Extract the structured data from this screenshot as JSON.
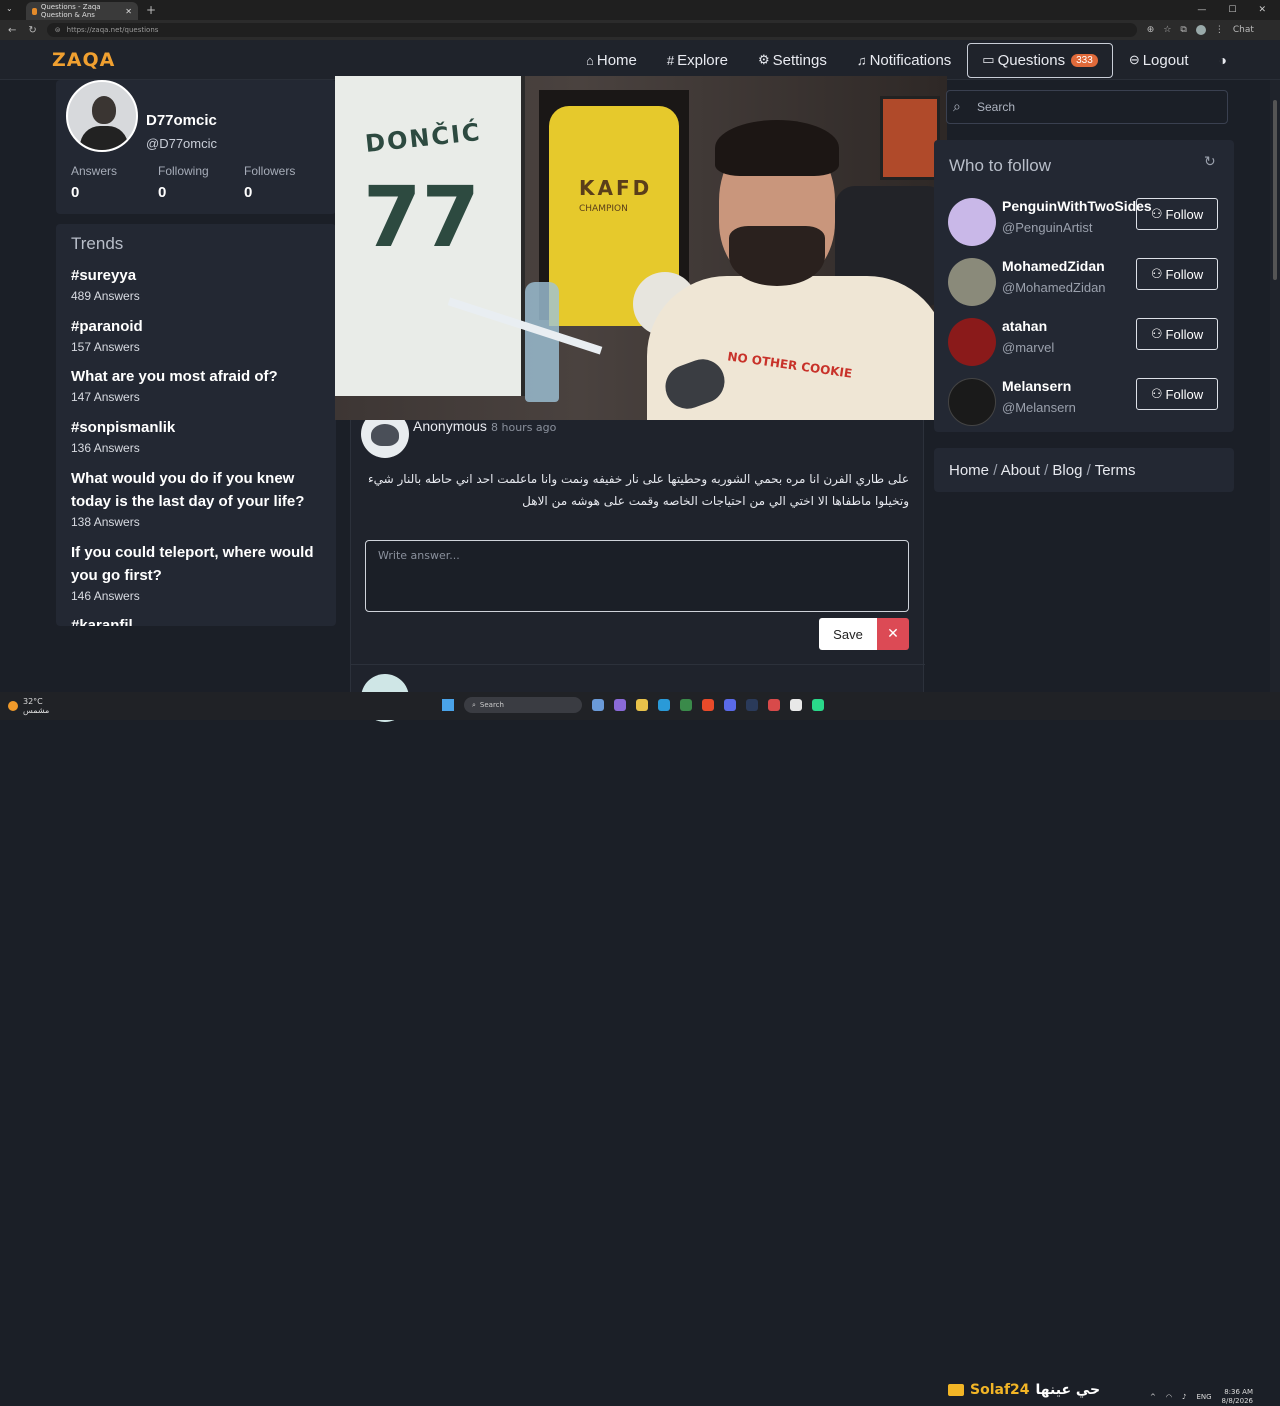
{
  "browser": {
    "tab_title": "Questions - Zaqa Question & Ans",
    "url": "https://zaqa.net/questions",
    "chat_label": "Chat"
  },
  "site": {
    "logo": "ZAQA",
    "nav": [
      {
        "label": "Home",
        "icon": "home-icon"
      },
      {
        "label": "Explore",
        "icon": "hash-icon"
      },
      {
        "label": "Settings",
        "icon": "gear-icon"
      },
      {
        "label": "Notifications",
        "icon": "bell-icon"
      },
      {
        "label": "Questions",
        "icon": "chat-icon",
        "badge": "333"
      },
      {
        "label": "Logout",
        "icon": "logout-icon"
      }
    ]
  },
  "profile": {
    "name": "D77omcic",
    "handle": "@D77omcic",
    "stats": [
      {
        "label": "Answers",
        "value": "0"
      },
      {
        "label": "Following",
        "value": "0"
      },
      {
        "label": "Followers",
        "value": "0"
      }
    ]
  },
  "trends": {
    "title": "Trends",
    "items": [
      {
        "tag": "#sureyya",
        "count": "489 Answers"
      },
      {
        "tag": "#paranoid",
        "count": "157 Answers"
      },
      {
        "tag": "What are you most afraid of?",
        "count": "147 Answers"
      },
      {
        "tag": "#sonpismanlik",
        "count": "136 Answers"
      },
      {
        "tag": "What would you do if you knew today is the last day of your life?",
        "count": "138 Answers"
      },
      {
        "tag": "If you could teleport, where would you go first?",
        "count": "146 Answers"
      },
      {
        "tag": "#karanfil",
        "count": ""
      }
    ]
  },
  "question": {
    "author": "Anonymous",
    "time": "8 hours ago",
    "text": "على طاري الفرن انا مره بحمي الشوربه وحطيتها على نار خفيفه ونمت وانا ماعلمت احد اني حاطه بالنار شيء وتخيلوا ماطفاها الا اختي الي من احتياجات الخاصه وقمت على هوشه من الاهل",
    "answer_placeholder": "Write answer...",
    "save_label": "Save",
    "cancel_label": "✕"
  },
  "video": {
    "jersey_name": "DONČIĆ",
    "jersey_number": "77",
    "jersey2_text": "KAFD",
    "jersey2_sub": "CHAMPION",
    "shirt_text": "NO OTHER COOKIE"
  },
  "search": {
    "placeholder": "Search"
  },
  "who_to_follow": {
    "title": "Who to follow",
    "follow_label": "Follow",
    "users": [
      {
        "name": "PenguinWithTwoSides",
        "handle": "@PenguinArtist",
        "color": "#c9b8e8"
      },
      {
        "name": "MohamedZidan",
        "handle": "@MohamedZidan",
        "color": "#8a8a7a"
      },
      {
        "name": "atahan",
        "handle": "@marvel",
        "color": "#8a1a1a"
      },
      {
        "name": "Melansern",
        "handle": "@Melansern",
        "color": "#1a1a1a"
      }
    ]
  },
  "footer": {
    "links": [
      "Home",
      "About",
      "Blog",
      "Terms"
    ]
  },
  "taskbar": {
    "weather_temp": "32°C",
    "weather_desc": "مشمس",
    "search_label": "Search",
    "stream_tag": "Solaf24",
    "stream_arabic": "حي عينها",
    "lang": "ENG",
    "time": "8:36 AM",
    "date": "8/8/2026"
  }
}
